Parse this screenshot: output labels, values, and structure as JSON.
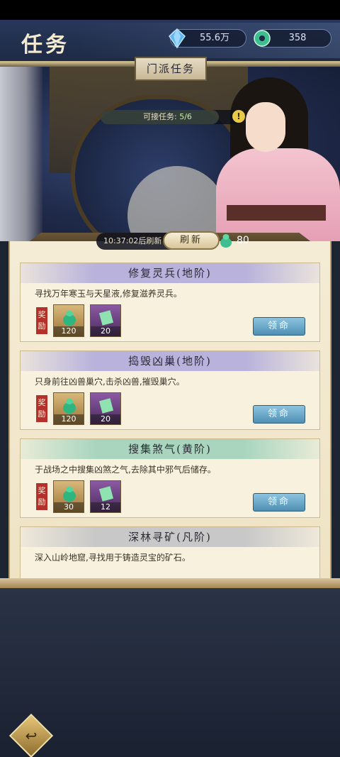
{
  "header": {
    "title": "任务",
    "spirit_stones": "55.6万",
    "jade": "358"
  },
  "sect_tab": "门派任务",
  "available": {
    "label": "可接任务:",
    "value": "5/6",
    "fraction": 0.8333
  },
  "refresh": {
    "timer_text": "10:37:02后刷新",
    "button_label": "刷新",
    "cost": "80"
  },
  "reward_label": "奖励",
  "tasks": [
    {
      "title": "修复灵兵(地阶)",
      "description": "寻找万年寒玉与天星液,修复滋养灵兵。",
      "tier_color": "#b8b2dc",
      "rewards": [
        {
          "icon": "jade-gourd-icon",
          "count": "120"
        },
        {
          "icon": "scroll-icon",
          "count": "20"
        }
      ],
      "accept_label": "领命"
    },
    {
      "title": "捣毁凶巢(地阶)",
      "description": "只身前往凶兽巢穴,击杀凶兽,摧毁巢穴。",
      "tier_color": "#b8b2dc",
      "rewards": [
        {
          "icon": "jade-gourd-icon",
          "count": "120"
        },
        {
          "icon": "scroll-icon",
          "count": "20"
        }
      ],
      "accept_label": "领命"
    },
    {
      "title": "搜集煞气(黄阶)",
      "description": "于战场之中搜集凶煞之气,去除其中邪气后储存。",
      "tier_color": "#a9d5bf",
      "rewards": [
        {
          "icon": "jade-gourd-icon",
          "count": "30"
        },
        {
          "icon": "scroll-icon",
          "count": "12"
        }
      ],
      "accept_label": "领命"
    },
    {
      "title": "深林寻矿(凡阶)",
      "description": "深入山岭地窟,寻找用于铸造灵宝的矿石。",
      "tier_color": "#c8c8c8"
    }
  ]
}
